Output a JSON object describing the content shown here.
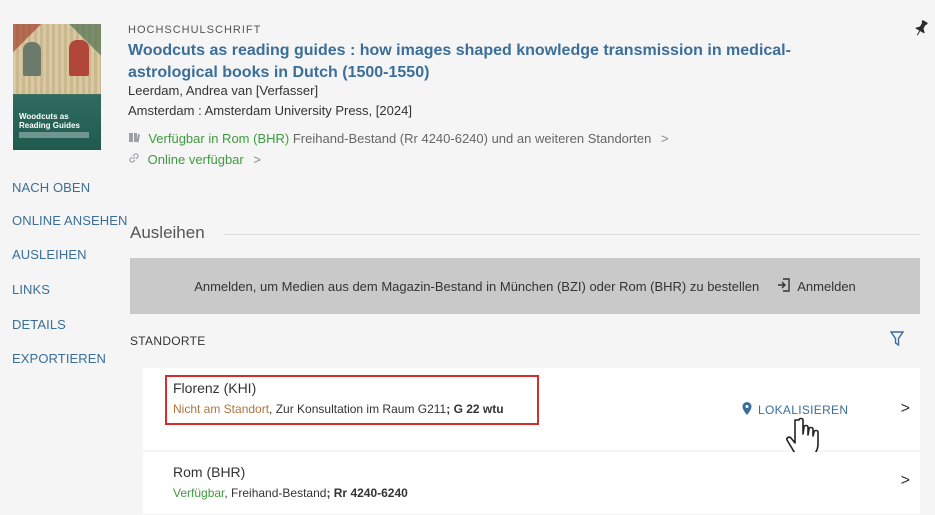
{
  "record": {
    "type": "HOCHSCHULSCHRIFT",
    "title": "Woodcuts as reading guides : how images shaped knowledge transmission in medical-astrological books in Dutch (1500-1550)",
    "author": "Leerdam, Andrea van [Verfasser]",
    "publication": "Amsterdam : Amsterdam University Press, [2024]",
    "availability": {
      "status": "Verfügbar in Rom (BHR)",
      "detail": "Freihand-Bestand (Rr 4240-6240) und an weiteren Standorten",
      "chevron": ">"
    },
    "online": {
      "label": "Online verfügbar",
      "chevron": ">"
    },
    "cover": {
      "title_line1": "Woodcuts as",
      "title_line2": "Reading Guides"
    }
  },
  "leftnav": [
    {
      "label": "NACH OBEN"
    },
    {
      "label": "ONLINE ANSEHEN"
    },
    {
      "label": "AUSLEIHEN"
    },
    {
      "label": "LINKS"
    },
    {
      "label": "DETAILS"
    },
    {
      "label": "EXPORTIEREN"
    }
  ],
  "ausleihen": {
    "heading": "Ausleihen",
    "login_message": "Anmelden, um Medien aus dem Magazin-Bestand in München (BZI) oder Rom (BHR) zu bestellen",
    "login_button": "Anmelden"
  },
  "standorte": {
    "heading": "STANDORTE",
    "locations": [
      {
        "name": "Florenz (KHI)",
        "status": "Nicht am Standort",
        "detail": ", Zur Konsultation im Raum G211",
        "callnumber": "; G 22 wtu",
        "action": "LOKALISIEREN",
        "chevron": ">"
      },
      {
        "name": "Rom (BHR)",
        "status": "Verfügbar",
        "detail": ", Freihand-Bestand",
        "callnumber": "; Rr 4240-6240",
        "chevron": ">"
      }
    ]
  },
  "colors": {
    "link": "#3b6e99",
    "available": "#3f9a3f",
    "unavailable": "#b2733a",
    "highlight": "#d32f2f"
  },
  "icons": [
    "book-icon",
    "link-icon",
    "pin-icon",
    "login-icon",
    "filter-icon",
    "location-pin-icon",
    "chevron-right-icon",
    "hand-cursor-icon"
  ]
}
